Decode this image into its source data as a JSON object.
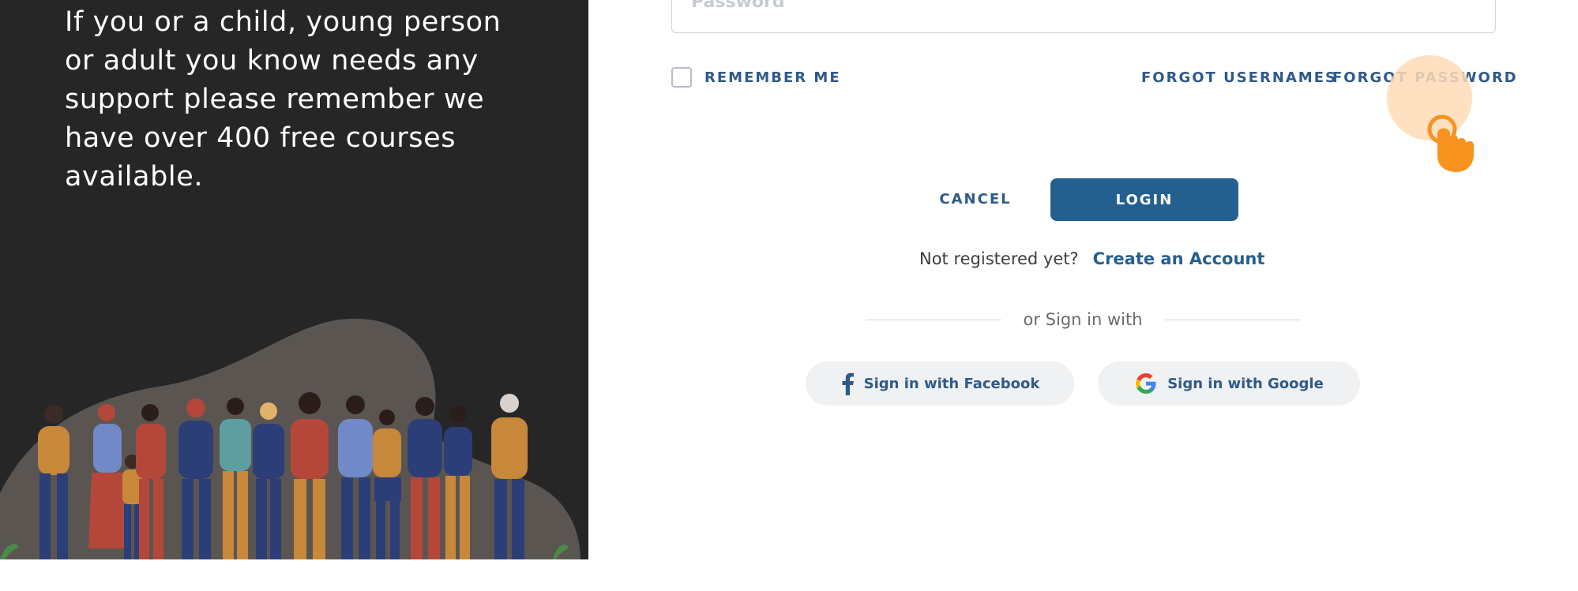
{
  "left_panel": {
    "message": "If you or a child, young person or adult you know needs any support please remember we have over 400 free courses available."
  },
  "form": {
    "password_placeholder": "Password",
    "remember_me": "REMEMBER ME",
    "forgot_usernames": "FORGOT USERNAMES",
    "forgot_password": "FORGOT PASSWORD",
    "cancel": "CANCEL",
    "login": "LOGIN",
    "not_registered": "Not registered yet?",
    "create_account": "Create an Account",
    "or_sign_in_with": "or Sign in with",
    "facebook": "Sign in with Facebook",
    "google": "Sign in with Google"
  },
  "colors": {
    "panel_bg": "#262626",
    "primary": "#24608f",
    "link": "#2e5a8a",
    "pointer_highlight": "#ffdcb6",
    "pointer_hand": "#f7931e"
  },
  "icons": {
    "pointer": "hand-pointer-icon",
    "facebook": "facebook-icon",
    "google": "google-icon"
  }
}
